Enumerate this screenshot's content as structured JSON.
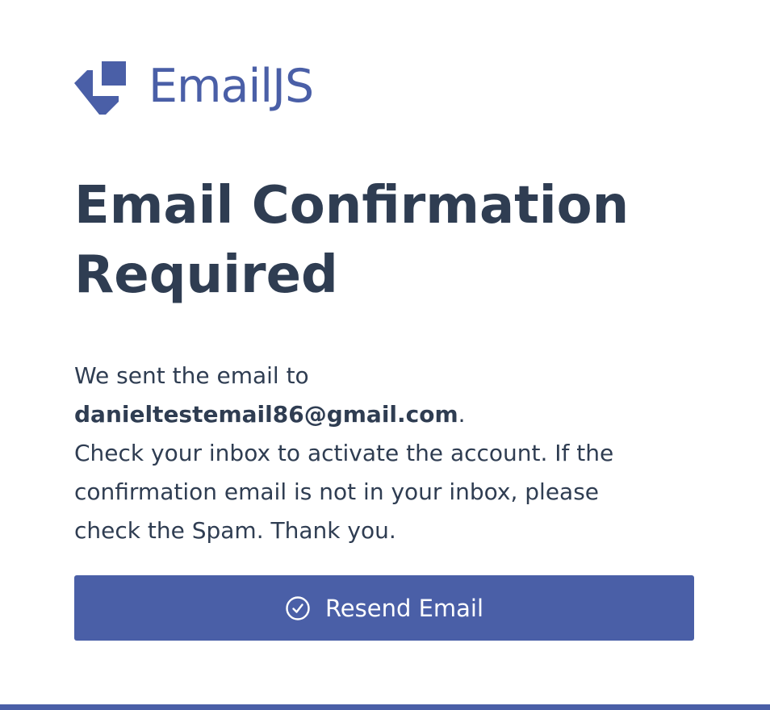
{
  "colors": {
    "brand": "#4a5fa7",
    "text": "#2f3d52",
    "button_text": "#ffffff"
  },
  "logo": {
    "icon": "emailjs-logo-icon",
    "text": "EmailJS"
  },
  "page": {
    "title_line1": "Email Confirmation",
    "title_line2": "Required"
  },
  "message": {
    "intro": "We sent the email to",
    "email": "danieltestemail86@gmail.com",
    "email_suffix": ".",
    "line3": "Check your inbox to activate the account. If the",
    "line4": "confirmation email is not in your inbox, please",
    "line5": "check the Spam. Thank you."
  },
  "resend_button": {
    "icon": "check-circle-icon",
    "label": "Resend Email"
  }
}
